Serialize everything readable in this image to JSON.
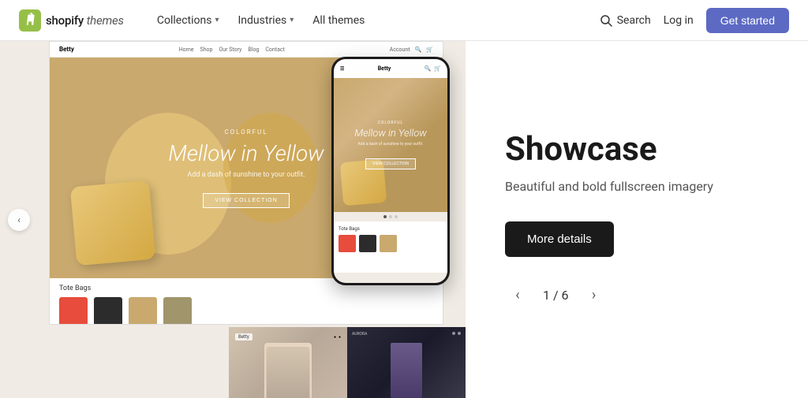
{
  "navbar": {
    "logo_text": "shopify",
    "logo_italic": "themes",
    "nav_items": [
      {
        "label": "Collections",
        "has_chevron": true
      },
      {
        "label": "Industries",
        "has_chevron": true
      },
      {
        "label": "All themes",
        "has_chevron": false
      }
    ],
    "search_label": "Search",
    "login_label": "Log in",
    "cta_label": "Get started"
  },
  "hero": {
    "desktop_nav_brand": "Betty",
    "desktop_nav_links": [
      "Home",
      "Shop",
      "Our Story",
      "Blog",
      "Contact"
    ],
    "desktop_sub": "Colorful",
    "desktop_title": "Mellow in Yellow",
    "desktop_desc": "Add a dash of sunshine to your outfit.",
    "desktop_cta": "VIEW COLLECTION",
    "desktop_section": "Tote Bags",
    "mobile_brand": "Betty",
    "mobile_sub": "Colorful",
    "mobile_title": "Mellow in Yellow",
    "mobile_desc": "Add a dash of sunshine to your outfit.",
    "mobile_cta": "VIEW COLLECTION"
  },
  "showcase": {
    "title": "Showcase",
    "description": "Beautiful and bold fullscreen imagery",
    "more_details_label": "More details",
    "current_page": "1",
    "total_pages": "6"
  }
}
